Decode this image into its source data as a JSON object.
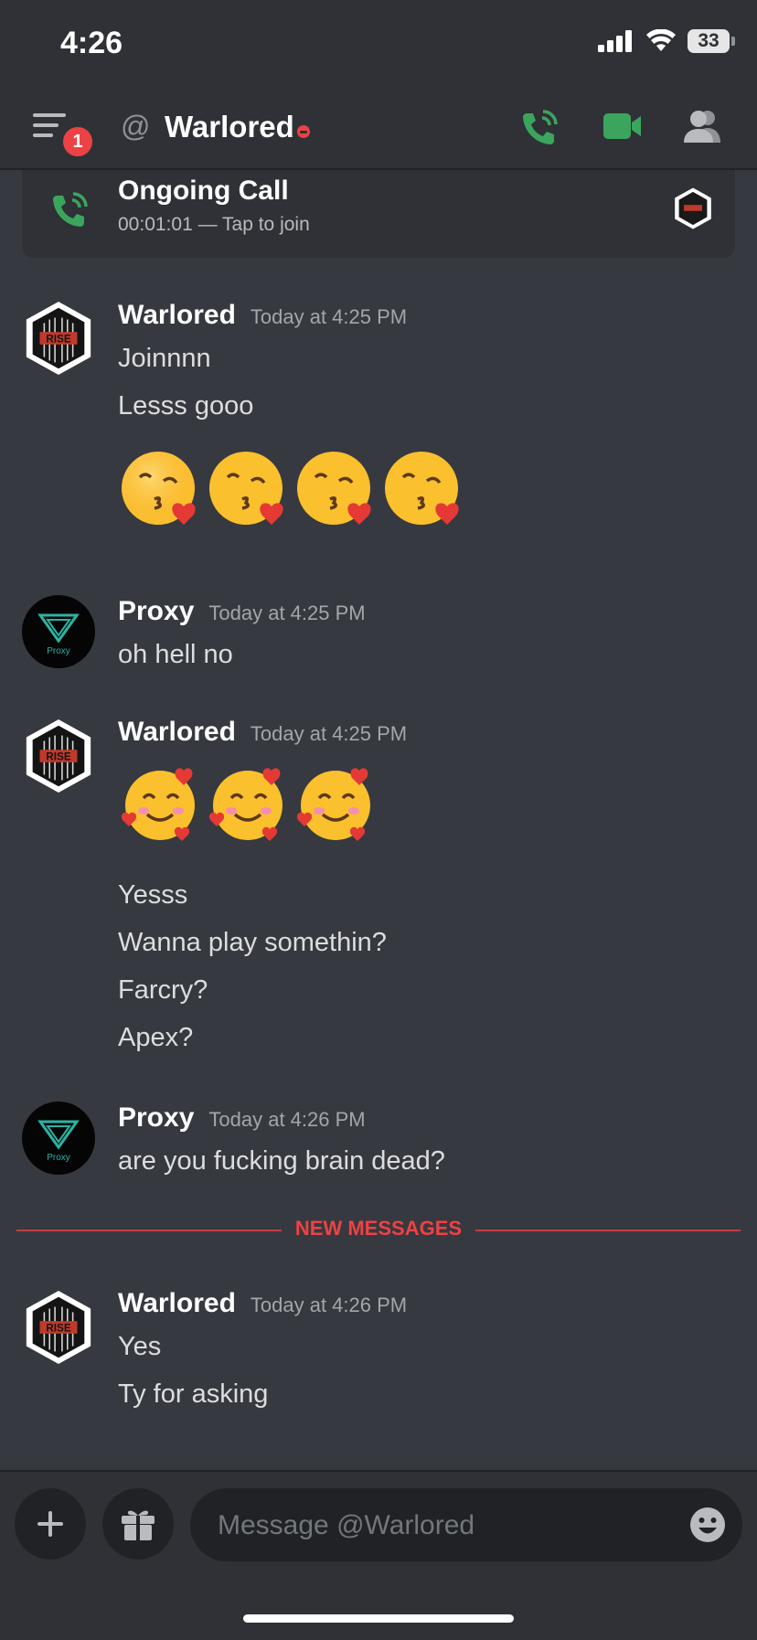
{
  "status_bar": {
    "time": "4:26",
    "battery": "33"
  },
  "header": {
    "notification_count": "1",
    "channel_name": "Warlored",
    "colors": {
      "call_green": "#3ba55d",
      "dnd_red": "#ed4245"
    }
  },
  "call": {
    "title": "Ongoing Call",
    "subtitle": "00:01:01 — Tap to join"
  },
  "messages": [
    {
      "author": "Warlored",
      "timestamp": "Today at 4:25 PM",
      "lines": [
        "Joinnnn",
        "Lesss gooo"
      ],
      "emoji": [
        "kissing-heart",
        "kissing-heart",
        "kissing-heart",
        "kissing-heart"
      ]
    },
    {
      "author": "Proxy",
      "timestamp": "Today at 4:25 PM",
      "lines": [
        "oh hell no"
      ]
    },
    {
      "author": "Warlored",
      "timestamp": "Today at 4:25 PM",
      "emoji": [
        "smiling-hearts",
        "smiling-hearts",
        "smiling-hearts"
      ],
      "lines": [
        "Yesss",
        "Wanna play somethin?",
        "Farcry?",
        "Apex?"
      ]
    },
    {
      "author": "Proxy",
      "timestamp": "Today at 4:26 PM",
      "lines": [
        "are you fucking brain dead?"
      ]
    },
    {
      "author": "Warlored",
      "timestamp": "Today at 4:26 PM",
      "lines": [
        "Yes",
        "Ty for asking"
      ]
    }
  ],
  "new_messages_label": "NEW MESSAGES",
  "composer": {
    "placeholder": "Message @Warlored"
  },
  "avatars": {
    "warlored_logo_text": "RISE",
    "proxy_logo_text": "Proxy"
  }
}
